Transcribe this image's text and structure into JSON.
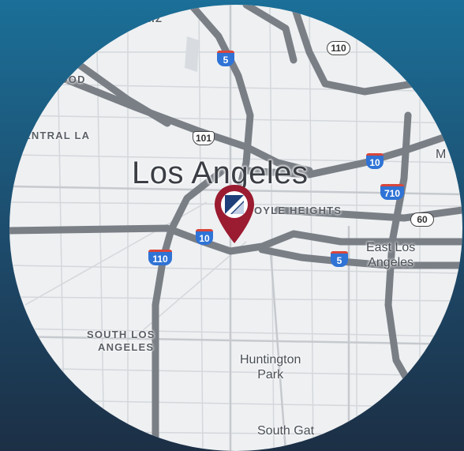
{
  "map": {
    "city_label": "Los Angeles",
    "districts": {
      "los_feliz": "FELIZ",
      "hollywood": "WOOD",
      "central_la": "ENTRAL LA",
      "boyle_heights": "OYLE HEIGHTS",
      "south_la_line1": "SOUTH LOS",
      "south_la_line2": "ANGELES"
    },
    "places": {
      "east_la_line1": "East Los",
      "east_la_line2": "Angeles",
      "huntington_line1": "Huntington",
      "huntington_line2": "Park",
      "south_gate": "South Gat",
      "edge_letter": "M"
    },
    "shields": {
      "i5_north": "5",
      "i5_east": "5",
      "i10_west": "10",
      "i10_east": "10",
      "i110": "110",
      "i710": "710",
      "us101": "101",
      "ca110": "110",
      "ca60": "60"
    },
    "marker": {
      "icon": "company-logo-icon",
      "color": "#9b1b30"
    },
    "colors": {
      "background_top": "#1b6f98",
      "background_bottom": "#1c2f45",
      "map_land": "#eef0f2",
      "freeway": "#7a7f86"
    }
  }
}
